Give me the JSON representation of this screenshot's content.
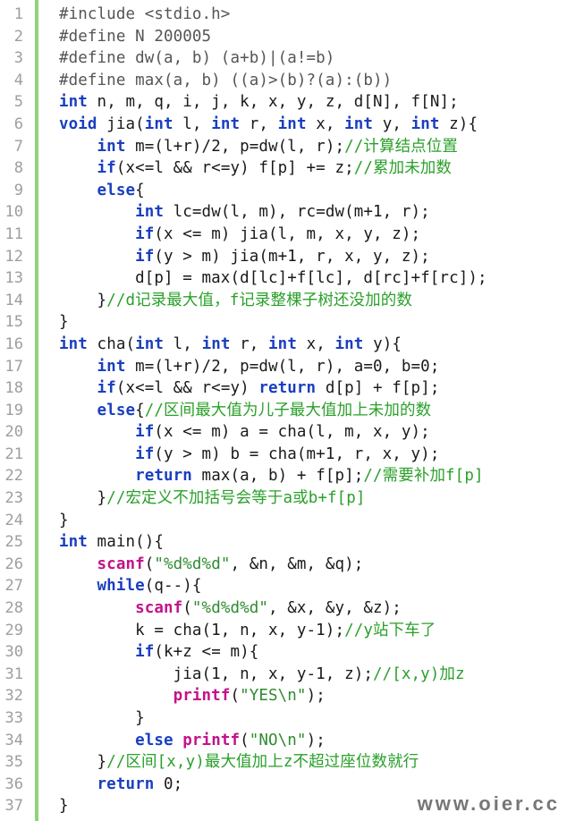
{
  "colors": {
    "keyword": "#1a3fbf",
    "function": "#c2138a",
    "string": "#2e8b2e",
    "comment": "#2aa02a",
    "preprocessor": "#555555",
    "line_number": "#9e9e9e",
    "gutter_bar": "#8fd47d"
  },
  "watermark": "www.oier.cc",
  "lines": [
    {
      "n": "1",
      "tokens": [
        {
          "t": "pre",
          "v": "#include <stdio.h>"
        }
      ]
    },
    {
      "n": "2",
      "tokens": [
        {
          "t": "pre",
          "v": "#define N 200005"
        }
      ]
    },
    {
      "n": "3",
      "tokens": [
        {
          "t": "pre",
          "v": "#define dw(a, b) (a+b)|(a!=b)"
        }
      ]
    },
    {
      "n": "4",
      "tokens": [
        {
          "t": "pre",
          "v": "#define max(a, b) ((a)>(b)?(a):(b))"
        }
      ]
    },
    {
      "n": "5",
      "tokens": [
        {
          "t": "ty",
          "v": "int"
        },
        {
          "t": "pl",
          "v": " n, m, q, i, j, k, x, y, z, d[N], f[N];"
        }
      ]
    },
    {
      "n": "6",
      "tokens": [
        {
          "t": "ty",
          "v": "void"
        },
        {
          "t": "pl",
          "v": " jia("
        },
        {
          "t": "ty",
          "v": "int"
        },
        {
          "t": "pl",
          "v": " l, "
        },
        {
          "t": "ty",
          "v": "int"
        },
        {
          "t": "pl",
          "v": " r, "
        },
        {
          "t": "ty",
          "v": "int"
        },
        {
          "t": "pl",
          "v": " x, "
        },
        {
          "t": "ty",
          "v": "int"
        },
        {
          "t": "pl",
          "v": " y, "
        },
        {
          "t": "ty",
          "v": "int"
        },
        {
          "t": "pl",
          "v": " z){"
        }
      ]
    },
    {
      "n": "7",
      "tokens": [
        {
          "t": "pl",
          "v": "    "
        },
        {
          "t": "ty",
          "v": "int"
        },
        {
          "t": "pl",
          "v": " m=(l+r)/2, p=dw(l, r);"
        },
        {
          "t": "cm",
          "v": "//计算结点位置"
        }
      ]
    },
    {
      "n": "8",
      "tokens": [
        {
          "t": "pl",
          "v": "    "
        },
        {
          "t": "kw",
          "v": "if"
        },
        {
          "t": "pl",
          "v": "(x<=l && r<=y) f[p] += z;"
        },
        {
          "t": "cm",
          "v": "//累加未加数"
        }
      ]
    },
    {
      "n": "9",
      "tokens": [
        {
          "t": "pl",
          "v": "    "
        },
        {
          "t": "kw",
          "v": "else"
        },
        {
          "t": "pl",
          "v": "{"
        }
      ]
    },
    {
      "n": "10",
      "tokens": [
        {
          "t": "pl",
          "v": "        "
        },
        {
          "t": "ty",
          "v": "int"
        },
        {
          "t": "pl",
          "v": " lc=dw(l, m), rc=dw(m+1, r);"
        }
      ]
    },
    {
      "n": "11",
      "tokens": [
        {
          "t": "pl",
          "v": "        "
        },
        {
          "t": "kw",
          "v": "if"
        },
        {
          "t": "pl",
          "v": "(x <= m) jia(l, m, x, y, z);"
        }
      ]
    },
    {
      "n": "12",
      "tokens": [
        {
          "t": "pl",
          "v": "        "
        },
        {
          "t": "kw",
          "v": "if"
        },
        {
          "t": "pl",
          "v": "(y > m) jia(m+1, r, x, y, z);"
        }
      ]
    },
    {
      "n": "13",
      "tokens": [
        {
          "t": "pl",
          "v": "        d[p] = max(d[lc]+f[lc], d[rc]+f[rc]);"
        }
      ]
    },
    {
      "n": "14",
      "tokens": [
        {
          "t": "pl",
          "v": "    }"
        },
        {
          "t": "cm",
          "v": "//d记录最大值，f记录整棵子树还没加的数"
        }
      ]
    },
    {
      "n": "15",
      "tokens": [
        {
          "t": "pl",
          "v": "}"
        }
      ]
    },
    {
      "n": "16",
      "tokens": [
        {
          "t": "ty",
          "v": "int"
        },
        {
          "t": "pl",
          "v": " cha("
        },
        {
          "t": "ty",
          "v": "int"
        },
        {
          "t": "pl",
          "v": " l, "
        },
        {
          "t": "ty",
          "v": "int"
        },
        {
          "t": "pl",
          "v": " r, "
        },
        {
          "t": "ty",
          "v": "int"
        },
        {
          "t": "pl",
          "v": " x, "
        },
        {
          "t": "ty",
          "v": "int"
        },
        {
          "t": "pl",
          "v": " y){"
        }
      ]
    },
    {
      "n": "17",
      "tokens": [
        {
          "t": "pl",
          "v": "    "
        },
        {
          "t": "ty",
          "v": "int"
        },
        {
          "t": "pl",
          "v": " m=(l+r)/2, p=dw(l, r), a=0, b=0;"
        }
      ]
    },
    {
      "n": "18",
      "tokens": [
        {
          "t": "pl",
          "v": "    "
        },
        {
          "t": "kw",
          "v": "if"
        },
        {
          "t": "pl",
          "v": "(x<=l && r<=y) "
        },
        {
          "t": "kw",
          "v": "return"
        },
        {
          "t": "pl",
          "v": " d[p] + f[p];"
        }
      ]
    },
    {
      "n": "19",
      "tokens": [
        {
          "t": "pl",
          "v": "    "
        },
        {
          "t": "kw",
          "v": "else"
        },
        {
          "t": "pl",
          "v": "{"
        },
        {
          "t": "cm",
          "v": "//区间最大值为儿子最大值加上未加的数"
        }
      ]
    },
    {
      "n": "20",
      "tokens": [
        {
          "t": "pl",
          "v": "        "
        },
        {
          "t": "kw",
          "v": "if"
        },
        {
          "t": "pl",
          "v": "(x <= m) a = cha(l, m, x, y);"
        }
      ]
    },
    {
      "n": "21",
      "tokens": [
        {
          "t": "pl",
          "v": "        "
        },
        {
          "t": "kw",
          "v": "if"
        },
        {
          "t": "pl",
          "v": "(y > m) b = cha(m+1, r, x, y);"
        }
      ]
    },
    {
      "n": "22",
      "tokens": [
        {
          "t": "pl",
          "v": "        "
        },
        {
          "t": "kw",
          "v": "return"
        },
        {
          "t": "pl",
          "v": " max(a, b) + f[p];"
        },
        {
          "t": "cm",
          "v": "//需要补加f[p]"
        }
      ]
    },
    {
      "n": "23",
      "tokens": [
        {
          "t": "pl",
          "v": "    }"
        },
        {
          "t": "cm",
          "v": "//宏定义不加括号会等于a或b+f[p]"
        }
      ]
    },
    {
      "n": "24",
      "tokens": [
        {
          "t": "pl",
          "v": "}"
        }
      ]
    },
    {
      "n": "25",
      "tokens": [
        {
          "t": "ty",
          "v": "int"
        },
        {
          "t": "pl",
          "v": " main(){"
        }
      ]
    },
    {
      "n": "26",
      "tokens": [
        {
          "t": "pl",
          "v": "    "
        },
        {
          "t": "fn",
          "v": "scanf"
        },
        {
          "t": "pl",
          "v": "("
        },
        {
          "t": "str",
          "v": "\"%d%d%d\""
        },
        {
          "t": "pl",
          "v": ", &n, &m, &q);"
        }
      ]
    },
    {
      "n": "27",
      "tokens": [
        {
          "t": "pl",
          "v": "    "
        },
        {
          "t": "kw",
          "v": "while"
        },
        {
          "t": "pl",
          "v": "(q--){"
        }
      ]
    },
    {
      "n": "28",
      "tokens": [
        {
          "t": "pl",
          "v": "        "
        },
        {
          "t": "fn",
          "v": "scanf"
        },
        {
          "t": "pl",
          "v": "("
        },
        {
          "t": "str",
          "v": "\"%d%d%d\""
        },
        {
          "t": "pl",
          "v": ", &x, &y, &z);"
        }
      ]
    },
    {
      "n": "29",
      "tokens": [
        {
          "t": "pl",
          "v": "        k = cha(1, n, x, y-1);"
        },
        {
          "t": "cm",
          "v": "//y站下车了"
        }
      ]
    },
    {
      "n": "30",
      "tokens": [
        {
          "t": "pl",
          "v": "        "
        },
        {
          "t": "kw",
          "v": "if"
        },
        {
          "t": "pl",
          "v": "(k+z <= m){"
        }
      ]
    },
    {
      "n": "31",
      "tokens": [
        {
          "t": "pl",
          "v": "            jia(1, n, x, y-1, z);"
        },
        {
          "t": "cm",
          "v": "//[x,y)加z"
        }
      ]
    },
    {
      "n": "32",
      "tokens": [
        {
          "t": "pl",
          "v": "            "
        },
        {
          "t": "fn",
          "v": "printf"
        },
        {
          "t": "pl",
          "v": "("
        },
        {
          "t": "str",
          "v": "\"YES\\n\""
        },
        {
          "t": "pl",
          "v": ");"
        }
      ]
    },
    {
      "n": "33",
      "tokens": [
        {
          "t": "pl",
          "v": "        }"
        }
      ]
    },
    {
      "n": "34",
      "tokens": [
        {
          "t": "pl",
          "v": "        "
        },
        {
          "t": "kw",
          "v": "else"
        },
        {
          "t": "pl",
          "v": " "
        },
        {
          "t": "fn",
          "v": "printf"
        },
        {
          "t": "pl",
          "v": "("
        },
        {
          "t": "str",
          "v": "\"NO\\n\""
        },
        {
          "t": "pl",
          "v": ");"
        }
      ]
    },
    {
      "n": "35",
      "tokens": [
        {
          "t": "pl",
          "v": "    }"
        },
        {
          "t": "cm",
          "v": "//区间[x,y)最大值加上z不超过座位数就行"
        }
      ]
    },
    {
      "n": "36",
      "tokens": [
        {
          "t": "pl",
          "v": "    "
        },
        {
          "t": "kw",
          "v": "return"
        },
        {
          "t": "pl",
          "v": " 0;"
        }
      ]
    },
    {
      "n": "37",
      "tokens": [
        {
          "t": "pl",
          "v": "}"
        }
      ]
    }
  ]
}
